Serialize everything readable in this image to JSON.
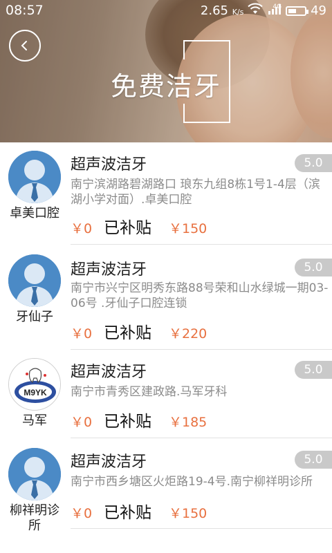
{
  "status_bar": {
    "time": "08:57",
    "speed": "2.65",
    "speed_unit": "K/s",
    "network": "4G",
    "battery": "49",
    "battery_level": 0.49
  },
  "header": {
    "title": "免费洁牙"
  },
  "currency": "￥",
  "items": [
    {
      "clinic": "卓美口腔",
      "service": "超声波洁牙",
      "rating": "5.0",
      "address": "南宁滨湖路碧湖路口 琅东九组8栋1号1-4层（滨湖小学对面）.卓美口腔",
      "price_now": "￥0",
      "subsidy": "已补贴",
      "price_orig": "￥150"
    },
    {
      "clinic": "牙仙子",
      "service": "超声波洁牙",
      "rating": "5.0",
      "address": "南宁市兴宁区明秀东路88号荣和山水绿城一期03-06号 .牙仙子口腔连锁",
      "price_now": "￥0",
      "subsidy": "已补贴",
      "price_orig": "￥220"
    },
    {
      "clinic": "马军",
      "service": "超声波洁牙",
      "rating": "5.0",
      "address": "南宁市青秀区建政路.马军牙科",
      "price_now": "￥0",
      "subsidy": "已补贴",
      "price_orig": "￥185",
      "logo_text": "M9YK"
    },
    {
      "clinic": "柳祥明诊所",
      "service": "超声波洁牙",
      "rating": "5.0",
      "address": "南宁市西乡塘区火炬路19-4号.南宁柳祥明诊所",
      "price_now": "￥0",
      "subsidy": "已补贴",
      "price_orig": "￥150"
    }
  ],
  "colors": {
    "price": "#e8703f",
    "rating_bg": "#c9c9c9",
    "avatar_blue": "#4b8ac6"
  }
}
